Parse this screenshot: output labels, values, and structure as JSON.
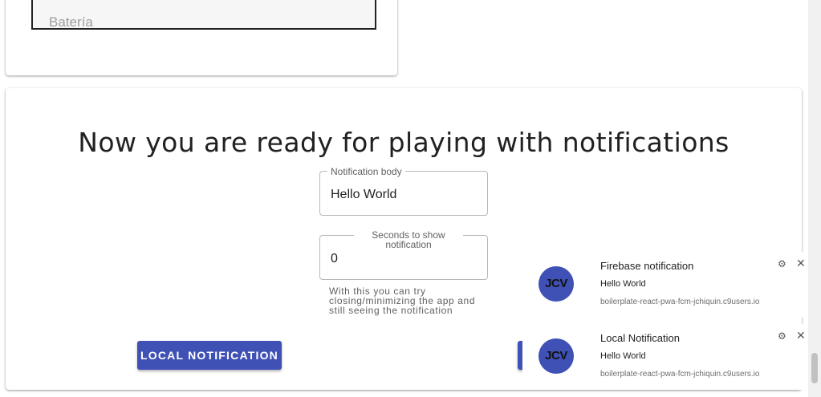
{
  "battery_field": {
    "placeholder": "Batería"
  },
  "main": {
    "heading": "Now you are ready for playing with notifications",
    "body_field": {
      "label": "Notification body",
      "value": "Hello World"
    },
    "seconds_field": {
      "label": "Seconds to show notification",
      "value": "0"
    },
    "helper_text": "With this you can try closing/minimizing the app and still seeing the notification",
    "local_button": "LOCAL NOTIFICATION"
  },
  "notifications": [
    {
      "avatar": "JCV",
      "title": "Firebase notification",
      "body": "Hello World",
      "origin": "boilerplate-react-pwa-fcm-jchiquin.c9users.io",
      "gear": "⚙",
      "close": "✕"
    },
    {
      "avatar": "JCV",
      "title": "Local Notification",
      "body": "Hello World",
      "origin": "boilerplate-react-pwa-fcm-jchiquin.c9users.io",
      "gear": "⚙",
      "close": "✕"
    }
  ],
  "colors": {
    "primary": "#3f51b5",
    "text": "#212121",
    "muted": "#616161"
  },
  "icons": {
    "settings": "gear-icon",
    "close": "close-icon"
  }
}
